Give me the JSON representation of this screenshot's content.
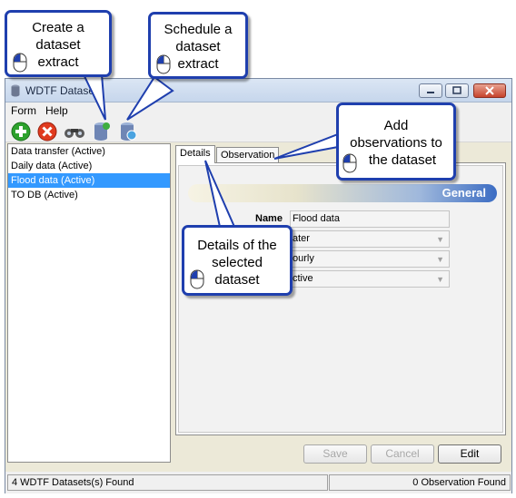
{
  "window": {
    "title": "WDTF Datasets"
  },
  "menu": [
    "Form",
    "Help"
  ],
  "toolbar": {
    "icons": [
      "add-icon",
      "delete-icon",
      "binoculars-icon",
      "dataset-extract-icon",
      "schedule-extract-icon"
    ]
  },
  "datasets": [
    {
      "label": "Data transfer (Active)",
      "selected": false
    },
    {
      "label": "Daily data (Active)",
      "selected": false
    },
    {
      "label": "Flood data (Active)",
      "selected": true
    },
    {
      "label": "TO DB (Active)",
      "selected": false
    }
  ],
  "tabs": [
    "Details",
    "Observation"
  ],
  "details": {
    "section_title": "General",
    "name_label": "Name",
    "name_value": "Flood data",
    "field2_value": "ater",
    "field3_value": "ourly",
    "field4_value": "ctive"
  },
  "buttons": {
    "save": "Save",
    "cancel": "Cancel",
    "edit": "Edit"
  },
  "status": {
    "left": "4 WDTF Datasets(s) Found",
    "right": "0 Observation Found"
  },
  "callouts": {
    "create_extract": [
      "Create a",
      "dataset",
      "extract"
    ],
    "schedule_extract": [
      "Schedule a",
      "dataset",
      "extract"
    ],
    "add_observations": [
      "Add",
      "observations to",
      "the dataset"
    ],
    "details_selected": [
      "Details of the",
      "selected",
      "dataset"
    ]
  },
  "colors": {
    "callout_border": "#1f3fae",
    "selection": "#3399ff",
    "general_bar_end": "#3b6cc3"
  }
}
